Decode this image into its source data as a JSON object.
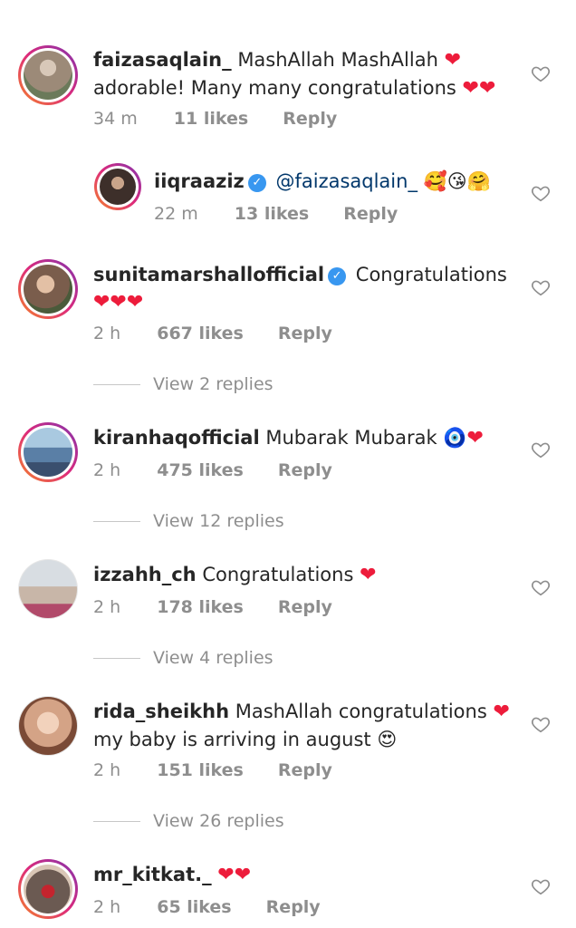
{
  "comments": [
    {
      "username": "faizasaqlain_",
      "text": "MashAllah MashAllah",
      "text2": "adorable! Many many congratulations",
      "time": "34 m",
      "likes": "11 likes",
      "reply": "Reply",
      "avatar_color": "#9c8a78"
    },
    {
      "username": "iiqraaziz",
      "mention": "@faizasaqlain_",
      "emojis": "🥰😘🤗",
      "time": "22 m",
      "likes": "13 likes",
      "reply": "Reply",
      "avatar_color": "#3d2f2a"
    },
    {
      "username": "sunitamarshallofficial",
      "text": "Congratulations",
      "time": "2 h",
      "likes": "667 likes",
      "reply": "Reply",
      "view_replies": "View 2 replies",
      "avatar_color": "#7a5d4c"
    },
    {
      "username": "kiranhaqofficial",
      "text": "Mubarak Mubarak",
      "emojis": "🧿",
      "time": "2 h",
      "likes": "475 likes",
      "reply": "Reply",
      "view_replies": "View 12 replies",
      "avatar_color": "#5a7fa6"
    },
    {
      "username": "izzahh_ch",
      "text": "Congratulations",
      "time": "2 h",
      "likes": "178 likes",
      "reply": "Reply",
      "view_replies": "View 4 replies",
      "avatar_color": "#c8b6a8"
    },
    {
      "username": "rida_sheikhh",
      "text": "MashAllah congratulations",
      "text2": "my baby is arriving in august",
      "emojis": "😍",
      "time": "2 h",
      "likes": "151 likes",
      "reply": "Reply",
      "view_replies": "View 26 replies",
      "avatar_color": "#d4a386"
    },
    {
      "username": "mr_kitkat._",
      "time": "2 h",
      "likes": "65 likes",
      "reply": "Reply",
      "avatar_color": "#6b5a52"
    }
  ],
  "colors": {
    "heart": "#ed1c3b",
    "verified": "#3897f0",
    "meta": "#8e8e8e"
  },
  "icons": {
    "like": "heart-outline-icon",
    "verified": "verified-badge-icon"
  }
}
